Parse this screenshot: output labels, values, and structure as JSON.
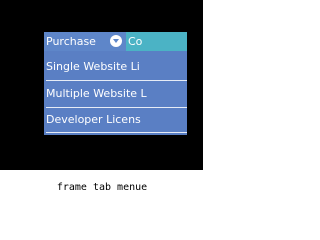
{
  "menu": {
    "tabs": [
      {
        "label": "Purchase",
        "icon": "chevron-down-icon"
      },
      {
        "label": "Co"
      }
    ],
    "dropdown_items": [
      "Single Website Li",
      "Multiple Website L",
      "Developer Licens"
    ]
  },
  "caption": "frame tab menue",
  "colors": {
    "background": "#000000",
    "tab_purchase": "#5e86c9",
    "tab_contact": "#4bb3c5",
    "dropdown": "#5a7fc4",
    "text": "#ffffff"
  }
}
